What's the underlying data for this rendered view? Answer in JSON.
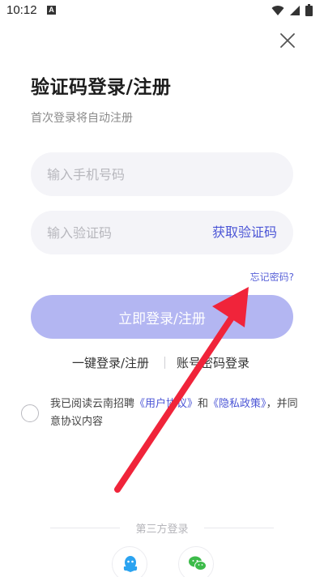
{
  "status_bar": {
    "time": "10:12",
    "notification_letter": "A",
    "icons": [
      "wifi-icon",
      "signal-icon",
      "battery-icon"
    ]
  },
  "close_icon": "close-icon",
  "header": {
    "title": "验证码登录/注册",
    "subtitle": "首次登录将自动注册"
  },
  "form": {
    "phone_placeholder": "输入手机号码",
    "code_placeholder": "输入验证码",
    "get_code_label": "获取验证码",
    "forgot_label": "忘记密码?",
    "login_label": "立即登录/注册"
  },
  "alt_login": {
    "one_click_label": "一键登录/注册",
    "password_label": "账号密码登录"
  },
  "agreement": {
    "prefix": "我已阅读云南招聘",
    "user_agreement": "《用户协议》",
    "connector": "和",
    "privacy_policy": "《隐私政策》",
    "suffix": "，并同意协议内容"
  },
  "third_party": {
    "label": "第三方登录",
    "providers": [
      "qq-icon",
      "wechat-icon"
    ]
  },
  "colors": {
    "accent": "#4b55d6",
    "button_disabled": "#b3b6f2",
    "annotation_arrow": "#f0243a"
  }
}
